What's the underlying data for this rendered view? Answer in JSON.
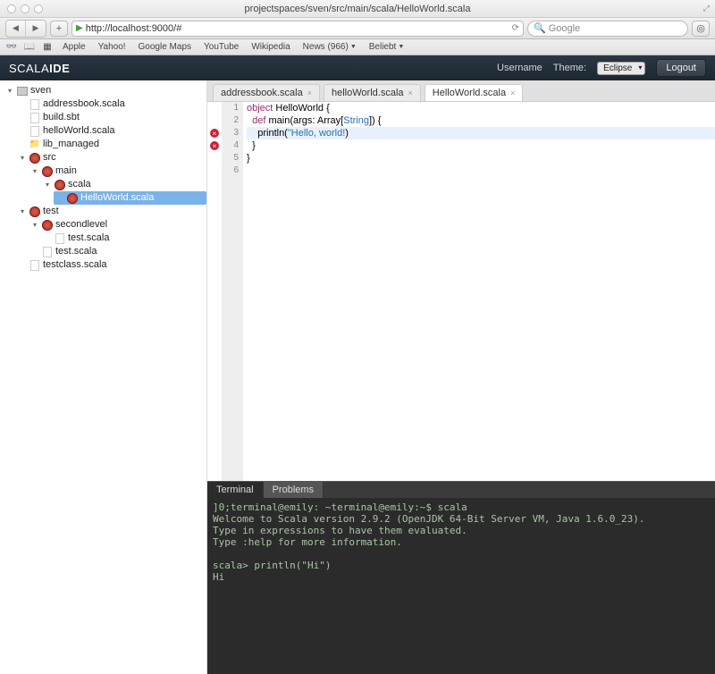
{
  "window": {
    "title": "projectspaces/sven/src/main/scala/HelloWorld.scala"
  },
  "browser": {
    "url": "http://localhost:9000/#",
    "search_placeholder": "Google"
  },
  "bookmarks": [
    "Apple",
    "Yahoo!",
    "Google Maps",
    "YouTube",
    "Wikipedia",
    "News (966)",
    "Beliebt"
  ],
  "header": {
    "logo_a": "SCALA",
    "logo_b": "IDE",
    "username": "Username",
    "theme_label": "Theme:",
    "theme_value": "Eclipse",
    "logout": "Logout"
  },
  "tree": {
    "root": "sven",
    "items": [
      {
        "name": "addressbook.scala",
        "icon": "file"
      },
      {
        "name": "build.sbt",
        "icon": "file"
      },
      {
        "name": "helloWorld.scala",
        "icon": "file"
      },
      {
        "name": "lib_managed",
        "icon": "folder"
      },
      {
        "name": "src",
        "icon": "scala-err",
        "children": [
          {
            "name": "main",
            "icon": "scala-err",
            "children": [
              {
                "name": "scala",
                "icon": "scala-err",
                "children": [
                  {
                    "name": "HelloWorld.scala",
                    "icon": "scala-err",
                    "selected": true
                  }
                ]
              }
            ]
          }
        ]
      },
      {
        "name": "test",
        "icon": "scala",
        "children": [
          {
            "name": "secondlevel",
            "icon": "scala",
            "children": [
              {
                "name": "test.scala",
                "icon": "file"
              }
            ]
          },
          {
            "name": "test.scala",
            "icon": "file"
          }
        ]
      },
      {
        "name": "testclass.scala",
        "icon": "file"
      }
    ]
  },
  "tabs": [
    {
      "label": "addressbook.scala",
      "active": false
    },
    {
      "label": "helloWorld.scala",
      "active": false
    },
    {
      "label": "HelloWorld.scala",
      "active": true
    }
  ],
  "code": {
    "lines": [
      {
        "n": 1,
        "html": "<span class='k-obj'>object</span> HelloWorld {"
      },
      {
        "n": 2,
        "html": "  <span class='k-def'>def</span> main(args: Array[<span class='k-typ'>String</span>]) {"
      },
      {
        "n": 3,
        "html": "    println(<span class='k-str'>\"Hello, world!</span>)",
        "err": true,
        "highlight": true
      },
      {
        "n": 4,
        "html": "  }",
        "err": true
      },
      {
        "n": 5,
        "html": "}"
      },
      {
        "n": 6,
        "html": " "
      }
    ]
  },
  "terminal": {
    "tabs": [
      "Terminal",
      "Problems"
    ],
    "active_tab": 0,
    "lines": [
      "]0;terminal@emily: ~terminal@emily:~$ scala",
      "Welcome to Scala version 2.9.2 (OpenJDK 64-Bit Server VM, Java 1.6.0_23).",
      "Type in expressions to have them evaluated.",
      "Type :help for more information.",
      "",
      "scala> println(\"Hi\")",
      "Hi"
    ]
  }
}
